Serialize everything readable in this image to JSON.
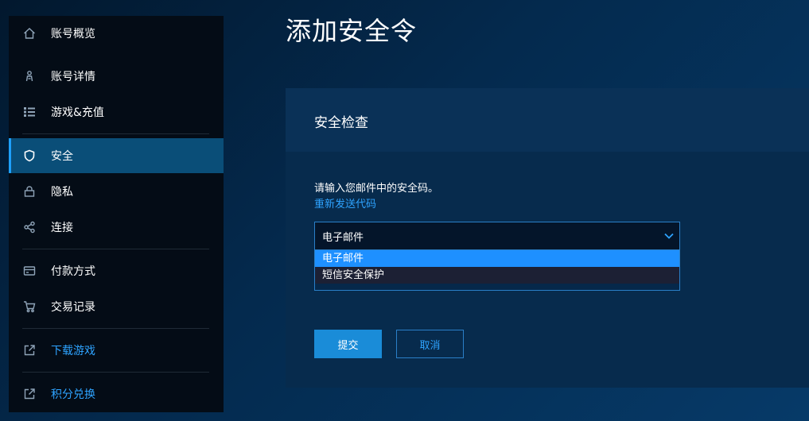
{
  "sidebar": {
    "items": [
      {
        "label": "账号概览",
        "icon": "home-icon"
      },
      {
        "label": "账号详情",
        "icon": "person-icon"
      },
      {
        "label": "游戏&充值",
        "icon": "list-icon"
      },
      {
        "label": "安全",
        "icon": "shield-icon",
        "active": true
      },
      {
        "label": "隐私",
        "icon": "lock-icon"
      },
      {
        "label": "连接",
        "icon": "share-icon"
      },
      {
        "label": "付款方式",
        "icon": "credit-card-icon"
      },
      {
        "label": "交易记录",
        "icon": "cart-icon"
      },
      {
        "label": "下载游戏",
        "icon": "external-link-icon"
      },
      {
        "label": "积分兑换",
        "icon": "external-link-icon"
      }
    ]
  },
  "main": {
    "title": "添加安全令",
    "card": {
      "title": "安全检查",
      "instruction": "请输入您邮件中的安全码。",
      "resend_link": "重新发送代码",
      "select": {
        "value": "电子邮件",
        "options": [
          "电子邮件",
          "短信安全保护"
        ]
      },
      "submit_label": "提交",
      "cancel_label": "取消"
    }
  },
  "colors": {
    "accent": "#1e90ff",
    "link": "#2ea3ff",
    "sidebar_bg": "#040c16",
    "active_item_bg": "#0a4e78"
  }
}
